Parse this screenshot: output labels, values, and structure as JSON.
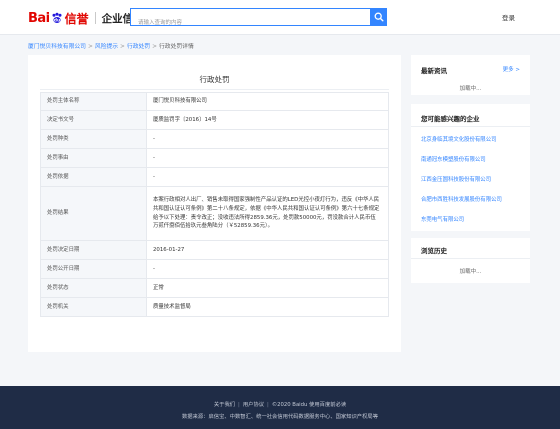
{
  "header": {
    "logo": {
      "bai": "Bai",
      "du_icon": "baidu-paw-icon",
      "xin": "信誉",
      "product": "企业信用"
    },
    "search": {
      "placeholder": "请输入查询的内容",
      "value": "",
      "icon": "search-icon"
    },
    "login": "登录"
  },
  "breadcrumb": {
    "items": [
      "厦门悦贝科技有限公司",
      "风险提示",
      "行政处罚"
    ],
    "current": "行政处罚详情",
    "separator": ">"
  },
  "main": {
    "title": "行政处罚",
    "rows": [
      {
        "label": "处罚主体名称",
        "value": "厦门悦贝科技有限公司"
      },
      {
        "label": "决定书文号",
        "value": "厦质监罚字〔2016〕14号"
      },
      {
        "label": "处罚种类",
        "value": "-"
      },
      {
        "label": "处罚事由",
        "value": "-"
      },
      {
        "label": "处罚依据",
        "value": "-"
      },
      {
        "label": "处罚结果",
        "value": "本案行政相对人出厂、销售未取得国家强制性产品认证的LED光控小夜灯行为，违反《中华人民共和国认证认可条例》第二十八条规定，依据《中华人民共和国认证认可条例》第六十七条规定给予以下处理：责令改正；没收违法所得2859.36元，处罚款50000元，罚没款合计人民币伍万贰仟捌佰伍拾玖元叁角陆分（￥52859.36元）。"
      },
      {
        "label": "处罚决定日期",
        "value": "2016-01-27"
      },
      {
        "label": "处罚公开日期",
        "value": "-"
      },
      {
        "label": "处罚状态",
        "value": "正常"
      },
      {
        "label": "处罚机关",
        "value": "质量技术监督局"
      }
    ]
  },
  "sidebar": {
    "news": {
      "title": "最新资讯",
      "more": "更多 >",
      "loading": "加载中..."
    },
    "interest": {
      "title": "您可能感兴趣的企业",
      "companies": [
        "北京身临其境文化股份有限公司",
        "南通冠东模塑股份有限公司",
        "江西金压圆科技股份有限公司",
        "合肥市西胜科技发展股份有限公司",
        "东莞电气有限公司"
      ]
    },
    "history": {
      "title": "浏览历史",
      "loading": "加载中..."
    }
  },
  "footer": {
    "links": [
      "关于我们",
      "用户协议"
    ],
    "copyright": "©2020 Baidu 使用百度前必读",
    "sources": "数据来源：启信宝、中数智汇、统一社会信用代码数据服务中心、国家知识产权局等"
  },
  "colors": {
    "brand_red": "#e10601",
    "accent_blue": "#3385ff",
    "footer_bg": "#1f2c46",
    "page_bg": "#f4f6f9"
  }
}
